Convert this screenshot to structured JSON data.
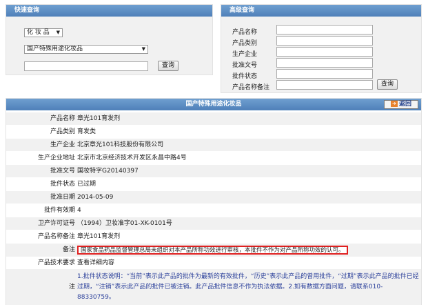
{
  "quick": {
    "title": "快速查询",
    "category_select": "化 妆 品",
    "type_select": "国产特殊用途化妆品",
    "search_value": "",
    "search_button": "查询"
  },
  "advanced": {
    "title": "高级查询",
    "fields": [
      {
        "label": "产品名称"
      },
      {
        "label": "产品类别"
      },
      {
        "label": "生产企业"
      },
      {
        "label": "批准文号"
      },
      {
        "label": "批件状态"
      },
      {
        "label": "产品名称备注"
      }
    ],
    "search_button": "查询"
  },
  "detail": {
    "title": "国产特殊用途化妆品",
    "back_label": "返回",
    "rows": [
      {
        "key": "产品名称",
        "value": "章光101育发剂"
      },
      {
        "key": "产品类别",
        "value": "育发类"
      },
      {
        "key": "生产企业",
        "value": "北京章光101科技股份有限公司"
      },
      {
        "key": "生产企业地址",
        "value": "北京市北京经济技术开发区永昌中路4号"
      },
      {
        "key": "批准文号",
        "value": "国妆特字G20140397"
      },
      {
        "key": "批件状态",
        "value": "已过期"
      },
      {
        "key": "批准日期",
        "value": "2014-05-09"
      },
      {
        "key": "批件有效期",
        "value": "4"
      },
      {
        "key": "卫产许可证号",
        "value": "（1994）卫妆准字01-XK-0101号"
      },
      {
        "key": "产品名称备注",
        "value": "章光101育发剂"
      }
    ],
    "note_key": "备注",
    "note_value": "国家食品药品监督管理总局未组织对本产品所称功效进行审核，本批件不作为对产品所称功效的认可。",
    "tech_key": "产品技术要求",
    "tech_value": "查看详细内容",
    "footnote_key": "注",
    "footnote": "1.批件状态说明：“当前”表示此产品的批件为最新的有效批件，“历史”表示此产品的曾用批件，“过期”表示此产品的批件已经过期，“注销”表示此产品的批件已被注销。此产品批件信息不作为执法依据。2.如有数据方面问题，请联系010-88330759。"
  }
}
